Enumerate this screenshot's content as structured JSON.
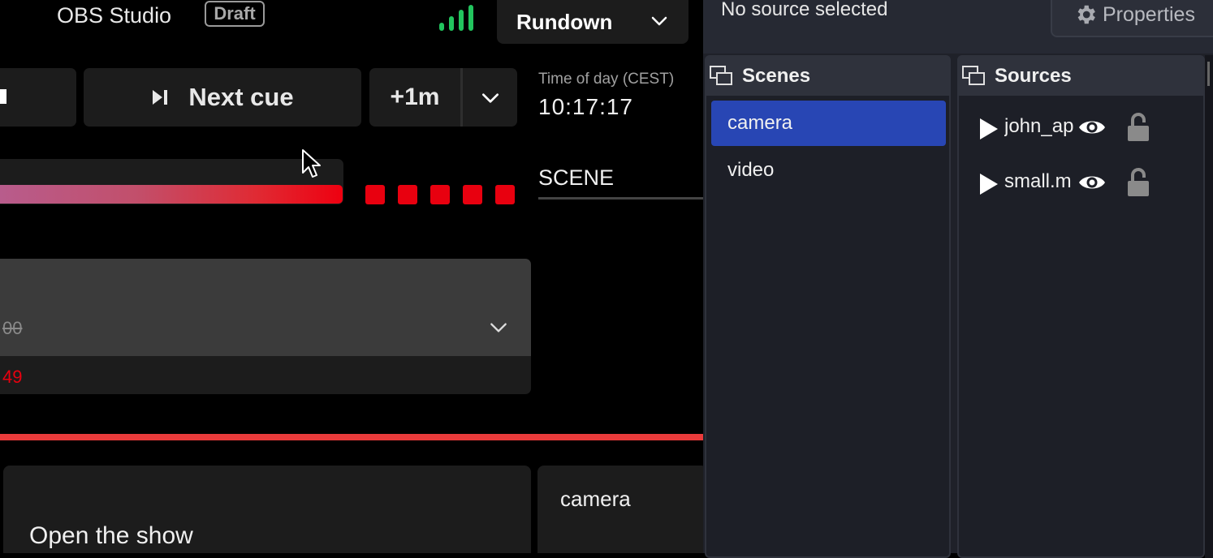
{
  "header": {
    "app_title": "OBS Studio",
    "status_badge": "Draft",
    "view_selector": "Rundown"
  },
  "controls": {
    "next_cue_label": "Next cue",
    "add_time_label": "+1m"
  },
  "clock": {
    "label": "Time of day (CEST)",
    "value": "10:17:17"
  },
  "progress": {
    "fill_fraction": 1.0,
    "overrun_markers": 5
  },
  "scene_column": {
    "label": "SCENE"
  },
  "cue": {
    "planned_time": "00",
    "overrun_time": "49"
  },
  "rundown_item": {
    "title": "Open the show",
    "scene": "camera"
  },
  "obs": {
    "source_status": "No source selected",
    "properties_label": "Properties",
    "scenes_title": "Scenes",
    "scenes": [
      {
        "label": "camera",
        "active": true
      },
      {
        "label": "video",
        "active": false
      }
    ],
    "sources_title": "Sources",
    "sources": [
      {
        "label": "john_ap"
      },
      {
        "label": "small.m"
      }
    ]
  },
  "colors": {
    "accent_red": "#e8000f",
    "live_green": "#22c55e",
    "selection_blue": "#2846b4"
  }
}
